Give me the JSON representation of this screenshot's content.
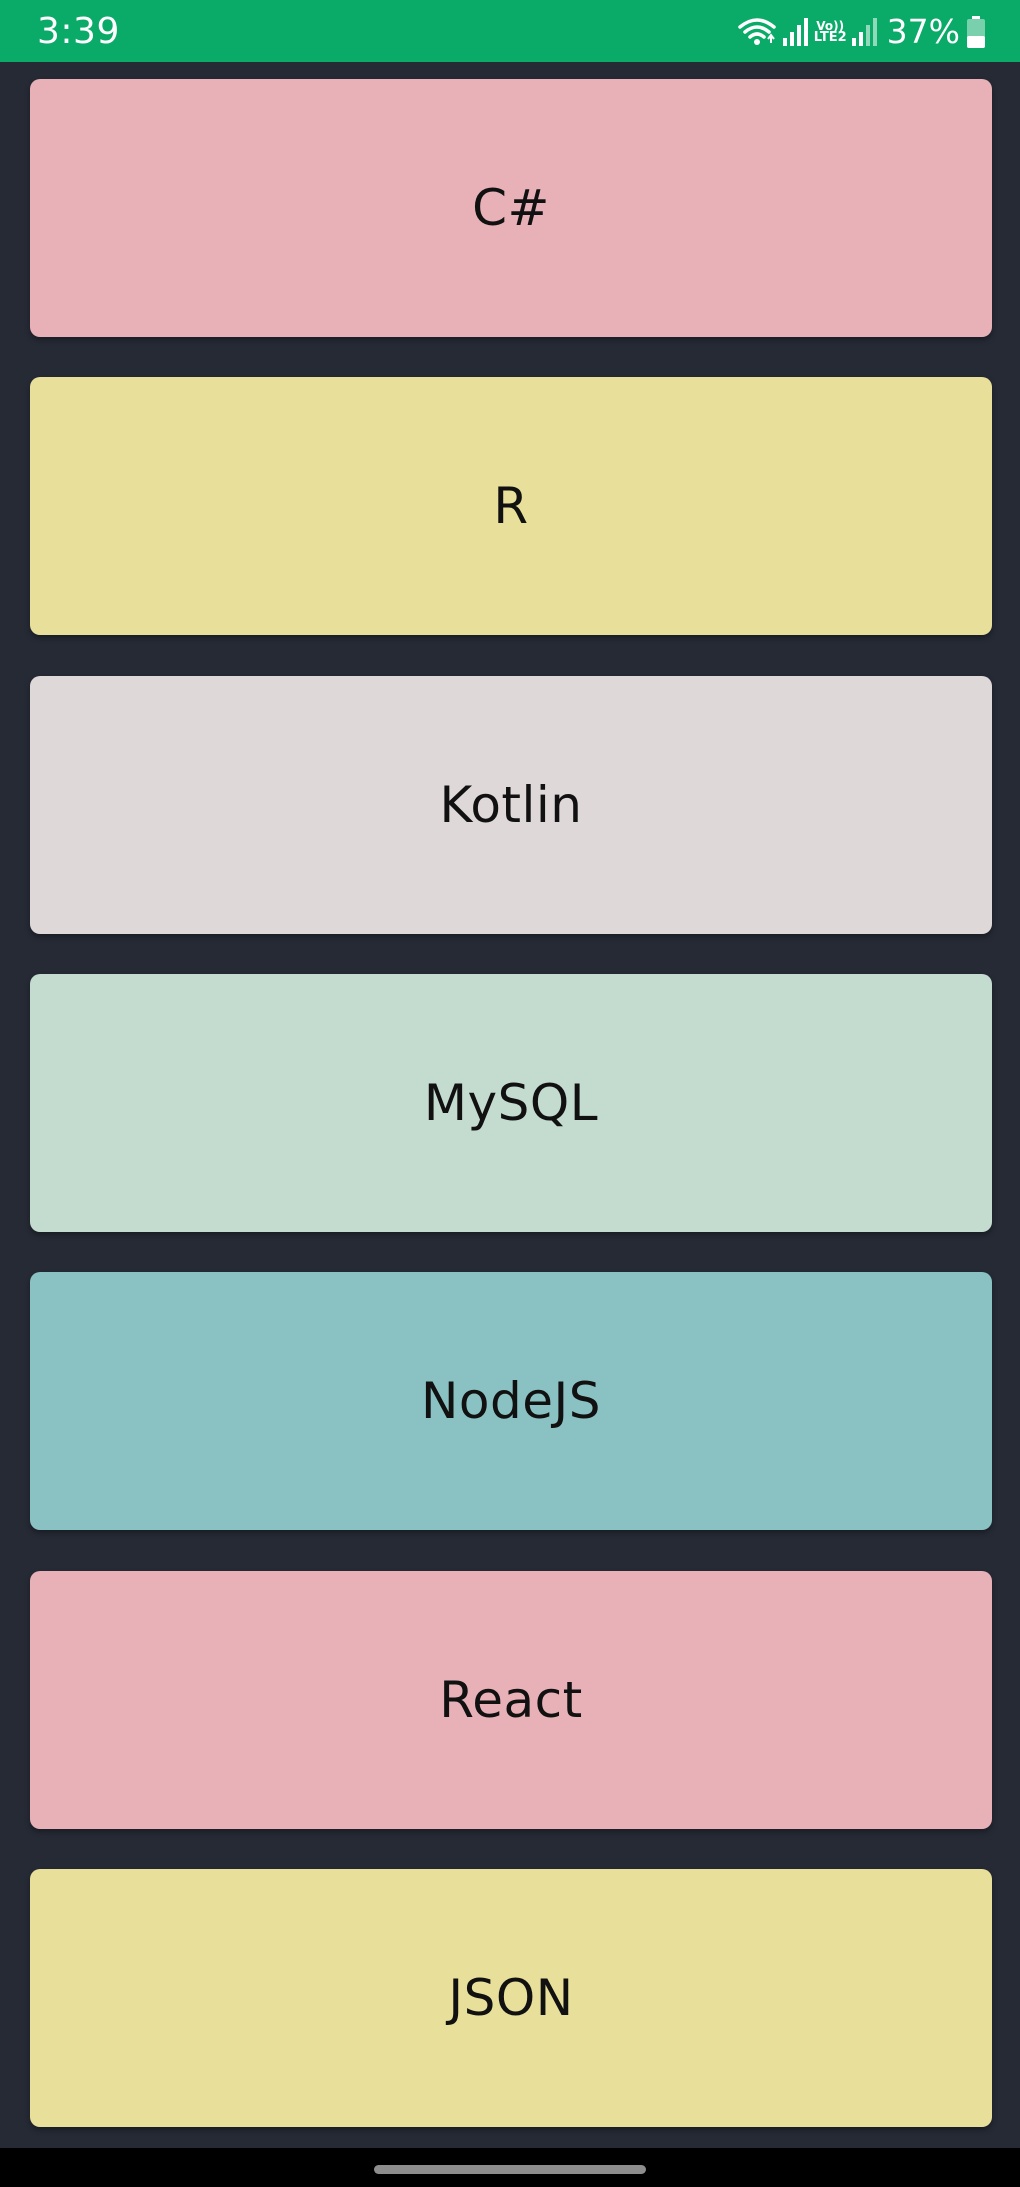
{
  "status_bar": {
    "time": "3:39",
    "network_top": "Vo))",
    "network_bottom": "LTE2",
    "battery": "37%",
    "icons": [
      "wifi-icon",
      "signal-icon",
      "signal-icon",
      "battery-icon"
    ]
  },
  "cards": [
    {
      "label": "C#",
      "color": "#e8b1b7"
    },
    {
      "label": "R",
      "color": "#e8e09a"
    },
    {
      "label": "Kotlin",
      "color": "#dfd8d9"
    },
    {
      "label": "MySQL",
      "color": "#c4dbd0"
    },
    {
      "label": "NodeJS",
      "color": "#8ac2c4"
    },
    {
      "label": "React",
      "color": "#e8b1b7"
    },
    {
      "label": "JSON",
      "color": "#e8e09a"
    }
  ],
  "colors": {
    "background": "#262a35",
    "status_bar": "#0aab69"
  }
}
